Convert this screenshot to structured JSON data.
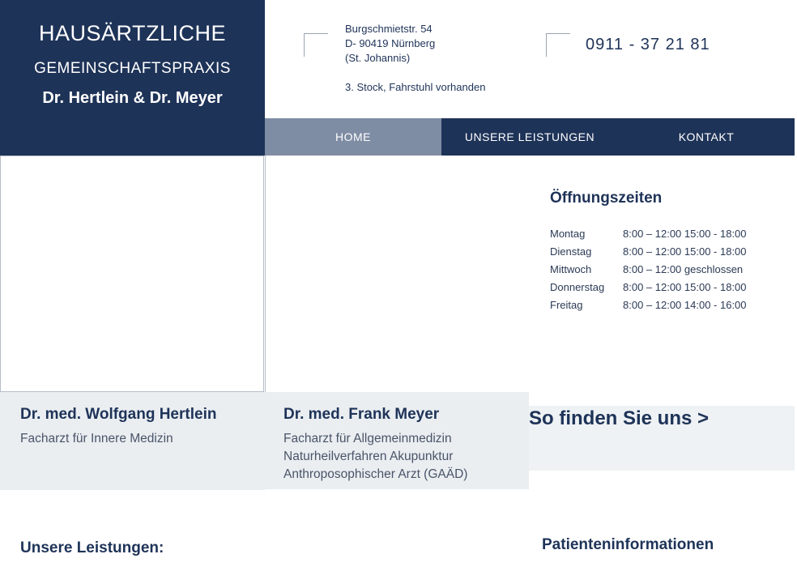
{
  "logo": {
    "line1": "HAUSÄRTZLICHE",
    "line2": "GEMEINSCHAFTSPRAXIS",
    "line3": "Dr. Hertlein & Dr. Meyer"
  },
  "contact": {
    "address_lines": [
      "Burgschmietstr. 54",
      "D- 90419 Nürnberg",
      "(St. Johannis)",
      "",
      "3. Stock, Fahrstuhl vorhanden"
    ],
    "phone": "0911 - 37 21 81"
  },
  "nav": {
    "items": [
      {
        "label": "HOME",
        "active": true
      },
      {
        "label": "UNSERE LEISTUNGEN",
        "active": false
      },
      {
        "label": "KONTAKT",
        "active": false
      }
    ]
  },
  "colors": {
    "brand_navy": "#1e3358",
    "nav_active": "#7e8ca4",
    "card_bg": "#eaeef1"
  },
  "doctors": [
    {
      "name": "Dr. med. Wolfgang Hertlein",
      "specialties": [
        "Facharzt für Innere Medizin"
      ]
    },
    {
      "name": "Dr. med. Frank Meyer",
      "specialties": [
        "Facharzt für Allgemeinmedizin",
        "Naturheilverfahren Akupunktur",
        "Anthroposophischer Arzt (GAÄD)"
      ]
    }
  ],
  "hours": {
    "title": "Öffnungszeiten",
    "rows": [
      {
        "day": "Montag",
        "time": "8:00 – 12:00 15:00 - 18:00"
      },
      {
        "day": "Dienstag",
        "time": "8:00 – 12:00 15:00 - 18:00"
      },
      {
        "day": "Mittwoch",
        "time": "8:00 – 12:00  geschlossen"
      },
      {
        "day": "Donnerstag",
        "time": "8:00 – 12:00 15:00 - 18:00"
      },
      {
        "day": "Freitag",
        "time": "8:00 – 12:00 14:00 - 16:00"
      }
    ]
  },
  "findus": {
    "label": "So finden Sie uns >"
  },
  "sections": {
    "leistungen_heading": "Unsere Leistungen:",
    "patinfo_heading": "Patienteninformationen"
  }
}
